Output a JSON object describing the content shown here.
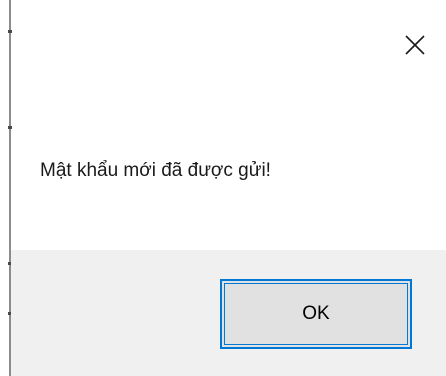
{
  "dialog": {
    "message": "Mật khẩu mới đã được gửi!",
    "ok_label": "OK",
    "close_icon": "close-icon"
  },
  "colors": {
    "accent": "#0078d7",
    "footer_bg": "#f0f0f0",
    "button_bg": "#e1e1e1",
    "text": "#1a1a1a"
  }
}
